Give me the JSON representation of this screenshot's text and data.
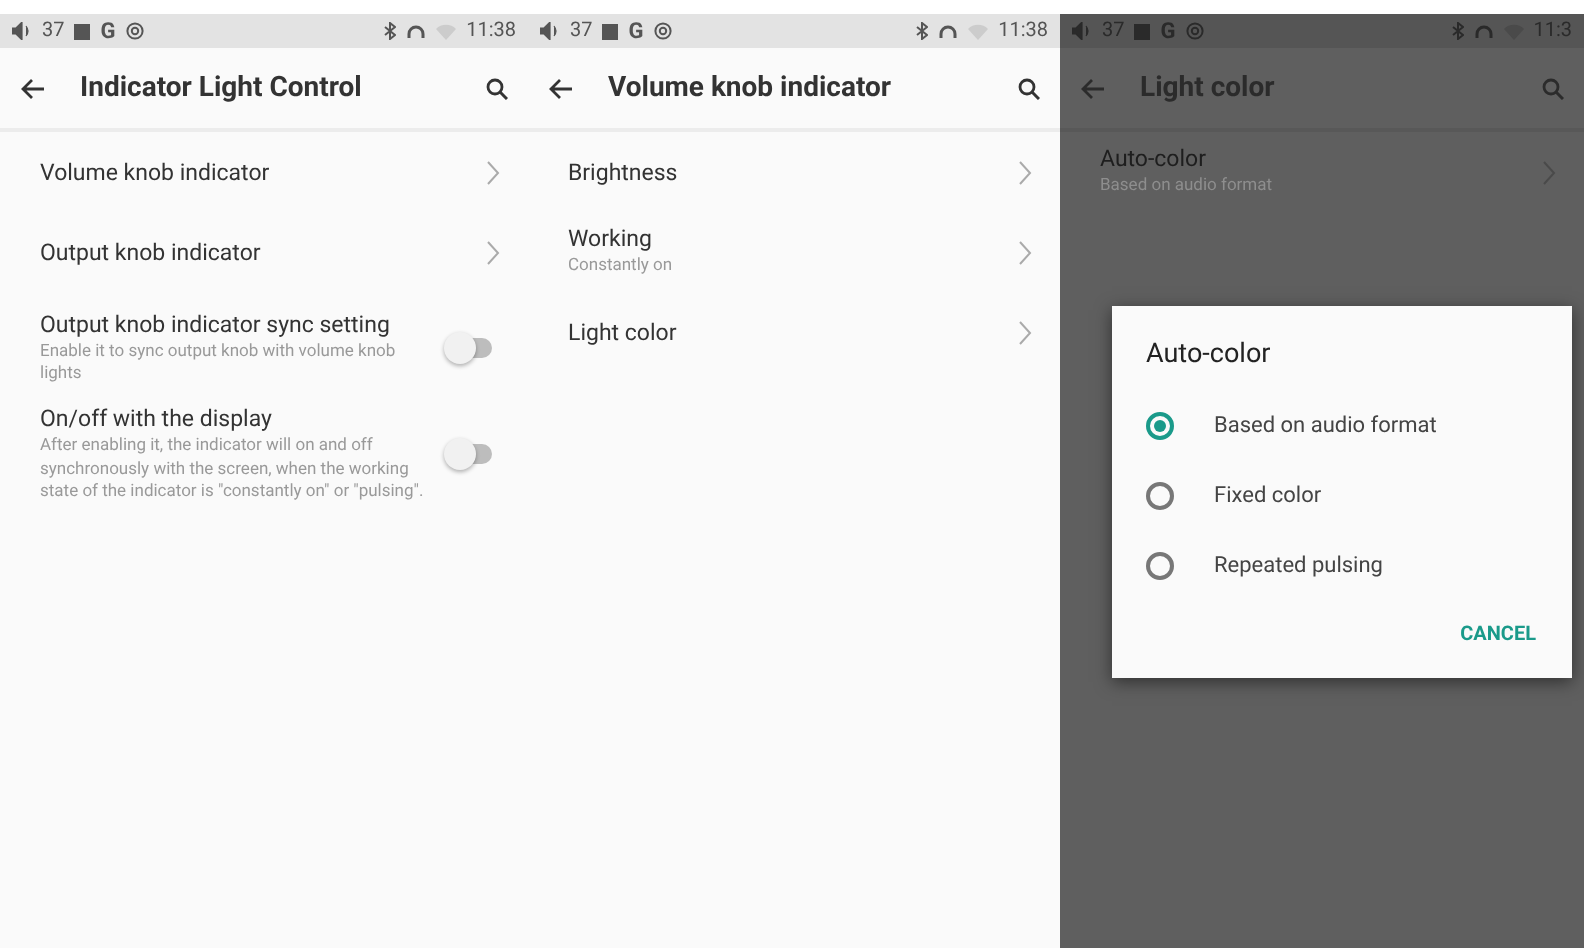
{
  "panels": [
    {
      "dimmed": false,
      "status_bar": {
        "volume": "37",
        "letter": "G",
        "time": "11:38"
      },
      "toolbar": {
        "title": "Indicator Light Control"
      },
      "items": [
        {
          "kind": "link",
          "title": "Volume knob indicator"
        },
        {
          "kind": "link",
          "title": "Output knob indicator"
        },
        {
          "kind": "switch",
          "title": "Output knob indicator sync setting",
          "subtitle": "Enable it to sync output knob with volume knob lights",
          "on": false
        },
        {
          "kind": "switch",
          "title": "On/off with the display",
          "subtitle": "After enabling it, the indicator will on and off synchronously with the screen, when the working state of the indicator is \"constantly on\" or \"pulsing\".",
          "on": false
        }
      ]
    },
    {
      "dimmed": false,
      "status_bar": {
        "volume": "37",
        "letter": "G",
        "time": "11:38"
      },
      "toolbar": {
        "title": "Volume knob indicator"
      },
      "items": [
        {
          "kind": "link",
          "title": "Brightness"
        },
        {
          "kind": "link",
          "title": "Working",
          "subtitle": "Constantly on"
        },
        {
          "kind": "link",
          "title": "Light color"
        }
      ]
    },
    {
      "dimmed": true,
      "status_bar": {
        "volume": "37",
        "letter": "G",
        "time": "11:3"
      },
      "toolbar": {
        "title": "Light color"
      },
      "items": [
        {
          "kind": "link",
          "title": "Auto-color",
          "subtitle": "Based on audio format"
        }
      ],
      "dialog": {
        "title": "Auto-color",
        "options": [
          {
            "label": "Based on audio format",
            "selected": true
          },
          {
            "label": "Fixed color",
            "selected": false
          },
          {
            "label": "Repeated pulsing",
            "selected": false
          }
        ],
        "button": "CANCEL"
      }
    }
  ]
}
